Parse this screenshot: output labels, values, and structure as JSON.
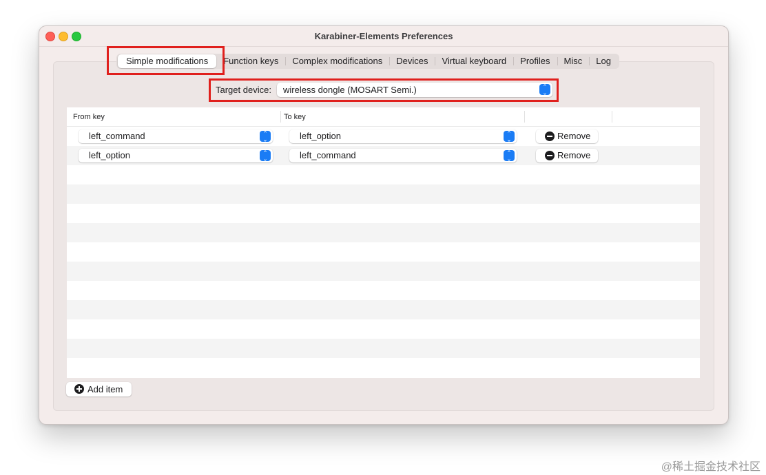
{
  "window": {
    "title": "Karabiner-Elements Preferences"
  },
  "tabs": [
    {
      "label": "Simple modifications",
      "active": true
    },
    {
      "label": "Function keys"
    },
    {
      "label": "Complex modifications"
    },
    {
      "label": "Devices"
    },
    {
      "label": "Virtual keyboard"
    },
    {
      "label": "Profiles"
    },
    {
      "label": "Misc"
    },
    {
      "label": "Log"
    }
  ],
  "target_device": {
    "label": "Target device:",
    "value": "wireless dongle (MOSART Semi.)"
  },
  "table": {
    "headers": {
      "from": "From key",
      "to": "To key"
    },
    "rows": [
      {
        "from": "left_command",
        "to": "left_option",
        "remove_label": "Remove"
      },
      {
        "from": "left_option",
        "to": "left_command",
        "remove_label": "Remove"
      }
    ]
  },
  "add_item": {
    "label": "Add item"
  },
  "colors": {
    "accent": "#1a7cf5",
    "highlight": "#e0201d"
  },
  "watermark": "@稀土掘金技术社区"
}
